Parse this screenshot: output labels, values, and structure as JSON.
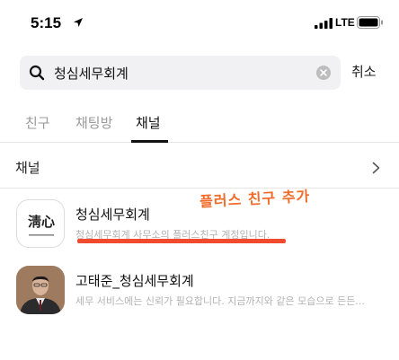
{
  "status": {
    "time": "5:15",
    "network": "LTE"
  },
  "search": {
    "value": "청심세무회계",
    "cancel_label": "취소"
  },
  "tabs": [
    {
      "label": "친구"
    },
    {
      "label": "채팅방"
    },
    {
      "label": "채널"
    }
  ],
  "section": {
    "title": "채널"
  },
  "results": [
    {
      "name": "청심세무회계",
      "description": "청심세무회계 사무소의 플러스친구 계정입니다.",
      "logo_text": "淸心"
    },
    {
      "name": "고태준_청심세무회계",
      "description": "세무 서비스에는 신뢰가 필요합니다. 지금까지와 같은 모습으로 든든..."
    }
  ],
  "annotation": {
    "text": "플러스 친구 추가",
    "color": "#f26b2a"
  }
}
